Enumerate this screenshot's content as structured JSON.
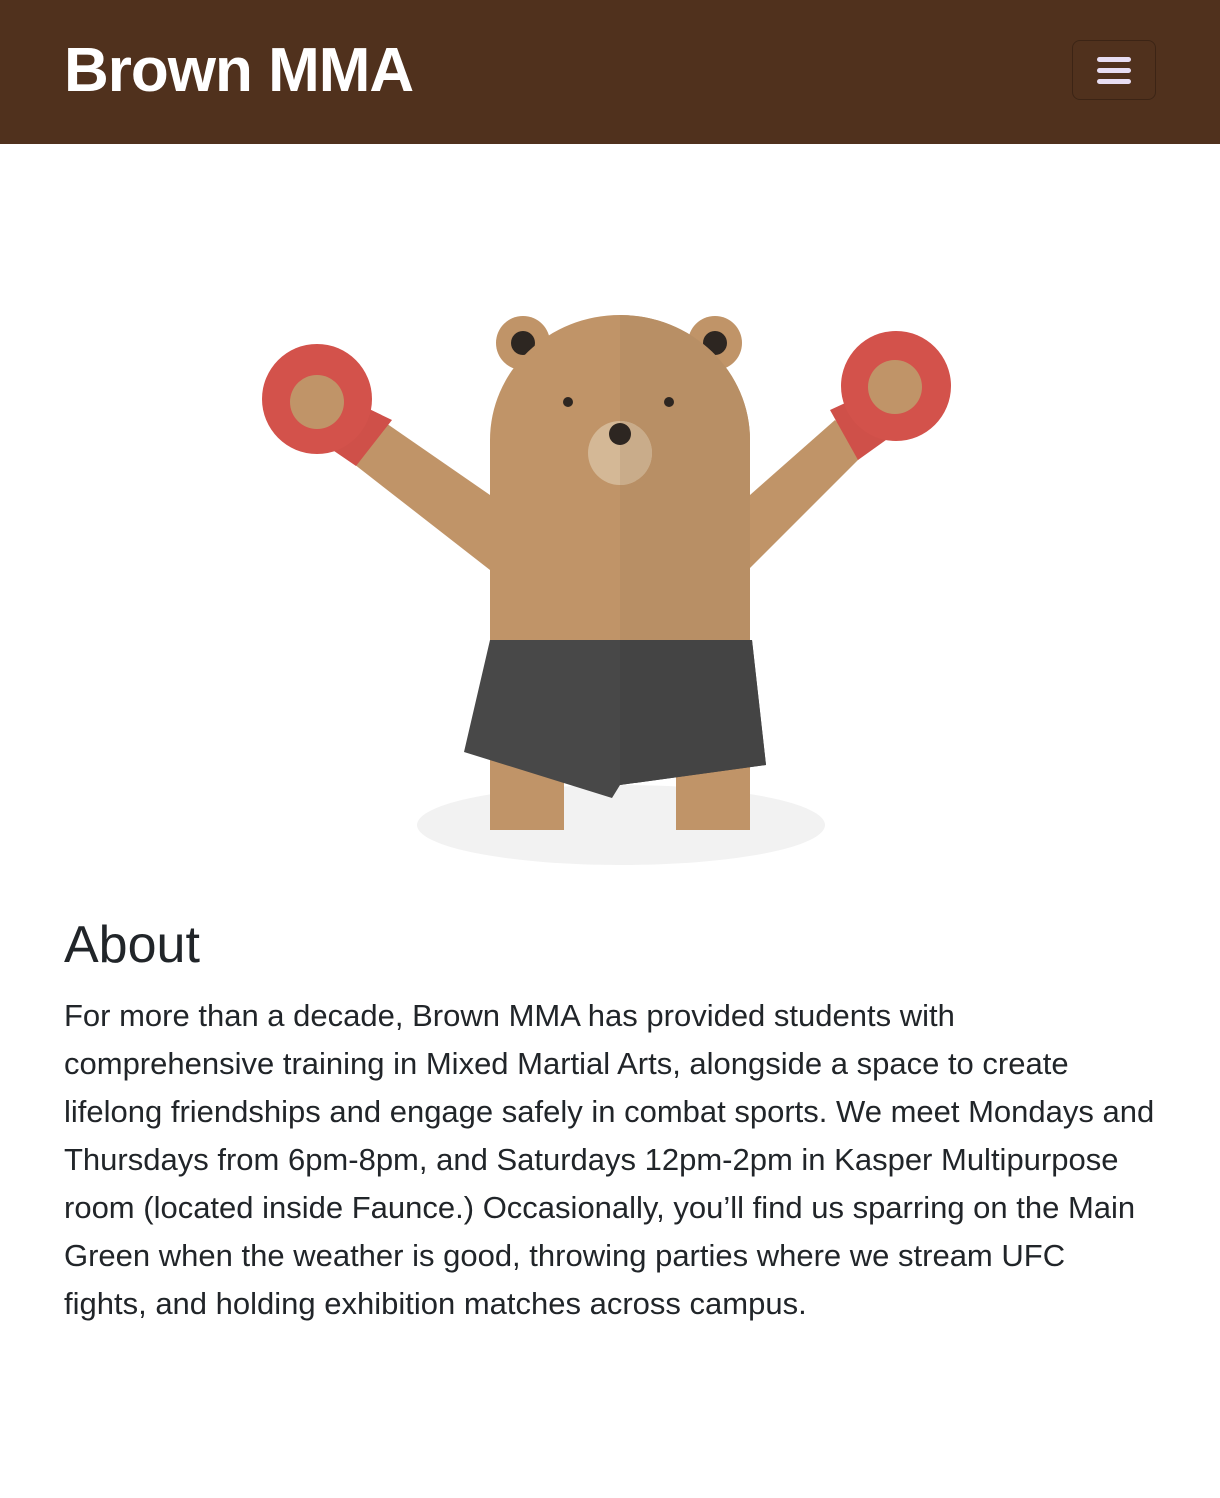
{
  "navbar": {
    "brand": "Brown MMA",
    "menu_icon": "hamburger-icon"
  },
  "hero": {
    "illustration": "boxing-bear-illustration",
    "colors": {
      "fur": "#c09468",
      "fur_shade": "#b88f65",
      "gloves": "#d3524b",
      "shorts": "#484848",
      "muzzle": "#d4b896",
      "shadow": "#f2f2f2"
    }
  },
  "about": {
    "heading": "About",
    "body": "For more than a decade, Brown MMA has provided students with comprehensive training in Mixed Martial Arts, alongside a space to create lifelong friendships and engage safely in combat sports. We meet Mondays and Thursdays from 6pm-8pm, and Saturdays 12pm-2pm in Kasper Multipurpose room (located inside Faunce.) Occasionally, you’ll find us sparring on the Main Green when the weather is good, throwing parties where we stream UFC fights, and holding exhibition matches across campus."
  },
  "theme": {
    "navbar_bg": "#50311d",
    "text": "#212529"
  }
}
